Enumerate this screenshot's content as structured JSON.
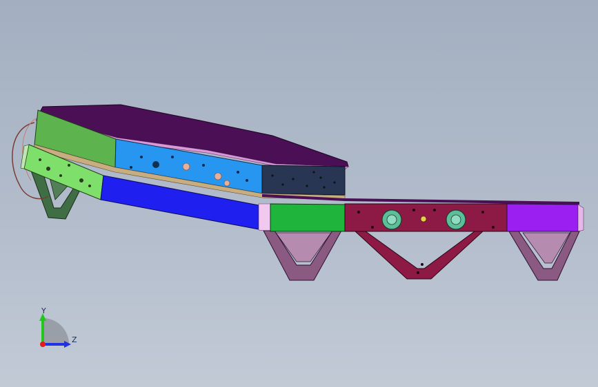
{
  "viewport": {
    "background_top": "#a3afc0",
    "background_bottom": "#c2cad6"
  },
  "triad": {
    "y_label": "Y",
    "z_label": "Z",
    "y_color": "#22c71c",
    "z_color": "#2232e0",
    "x_color": "#e01c1c"
  },
  "parts": {
    "top_plate": "#4a0f55",
    "green_side": "#5db44e",
    "light_green": "#7ee06a",
    "blue_panel": "#2796f0",
    "deep_blue_panel": "#1f1ff0",
    "dark_navy": "#283654",
    "green_box": "#1fb43c",
    "maroon_frame": "#8c1a45",
    "purple_box": "#9b1ff0",
    "support_mauve": "#8a5a82",
    "dark_green_support": "#3f6e45"
  }
}
